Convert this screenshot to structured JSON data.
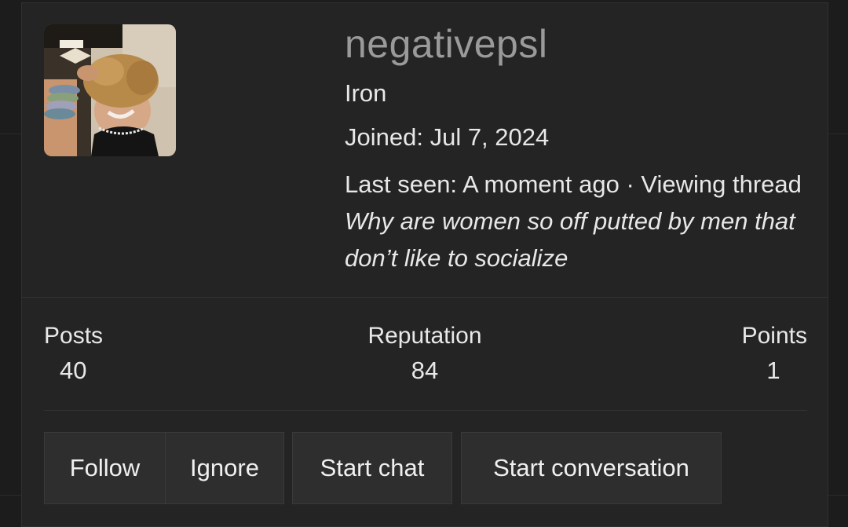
{
  "profile": {
    "username": "negativepsl",
    "rank": "Iron",
    "joined": "Joined: Jul 7, 2024",
    "last_seen_prefix": "Last seen: A moment ago · Viewing thread ",
    "last_seen_thread": "Why are women so off putted by men that don’t like to socialize"
  },
  "stats": {
    "posts_label": "Posts",
    "posts_value": "40",
    "reputation_label": "Reputation",
    "reputation_value": "84",
    "points_label": "Points",
    "points_value": "1"
  },
  "actions": {
    "follow": "Follow",
    "ignore": "Ignore",
    "start_chat": "Start chat",
    "start_conversation": "Start conversation"
  },
  "colors": {
    "background": "#1c1c1c",
    "card": "#242424",
    "username": "#9a9a9a",
    "text": "#e8e8e8",
    "button": "#2e2e2e"
  }
}
